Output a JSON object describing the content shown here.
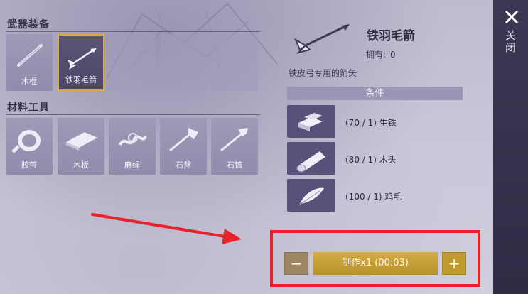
{
  "weapons": {
    "title": "武器装备",
    "slots": [
      {
        "label": "木棍",
        "icon": "wooden-stick-icon"
      },
      {
        "label": "铁羽毛箭",
        "icon": "iron-feather-arrow-icon",
        "selected": true
      },
      {
        "label": "",
        "icon": ""
      },
      {
        "label": "",
        "icon": ""
      },
      {
        "label": "",
        "icon": ""
      }
    ]
  },
  "materials": {
    "title": "材料工具",
    "slots": [
      {
        "label": "胶带",
        "icon": "tape-icon"
      },
      {
        "label": "木板",
        "icon": "wood-plank-icon"
      },
      {
        "label": "麻绳",
        "icon": "hemp-rope-icon"
      },
      {
        "label": "石斧",
        "icon": "stone-axe-icon"
      },
      {
        "label": "石镐",
        "icon": "stone-pickaxe-icon"
      }
    ]
  },
  "detail": {
    "name": "铁羽毛箭",
    "owned_label": "拥有:",
    "owned_value": "0",
    "description": "铁皮弓专用的箭矢",
    "conditions_title": "条件",
    "requirements": [
      {
        "text": "(70 / 1) 生铁",
        "icon": "pig-iron-icon"
      },
      {
        "text": "(80 / 1) 木头",
        "icon": "wood-log-icon"
      },
      {
        "text": "(100 / 1) 鸡毛",
        "icon": "chicken-feather-icon"
      }
    ]
  },
  "craft": {
    "minus": "−",
    "plus": "+",
    "button_label": "制作x1 (00:03)"
  },
  "sidebar": {
    "close_label": "关闭"
  },
  "colors": {
    "highlight": "#e8212b",
    "craft_button": "#c9a03a",
    "selected_border": "#d9a84a"
  }
}
